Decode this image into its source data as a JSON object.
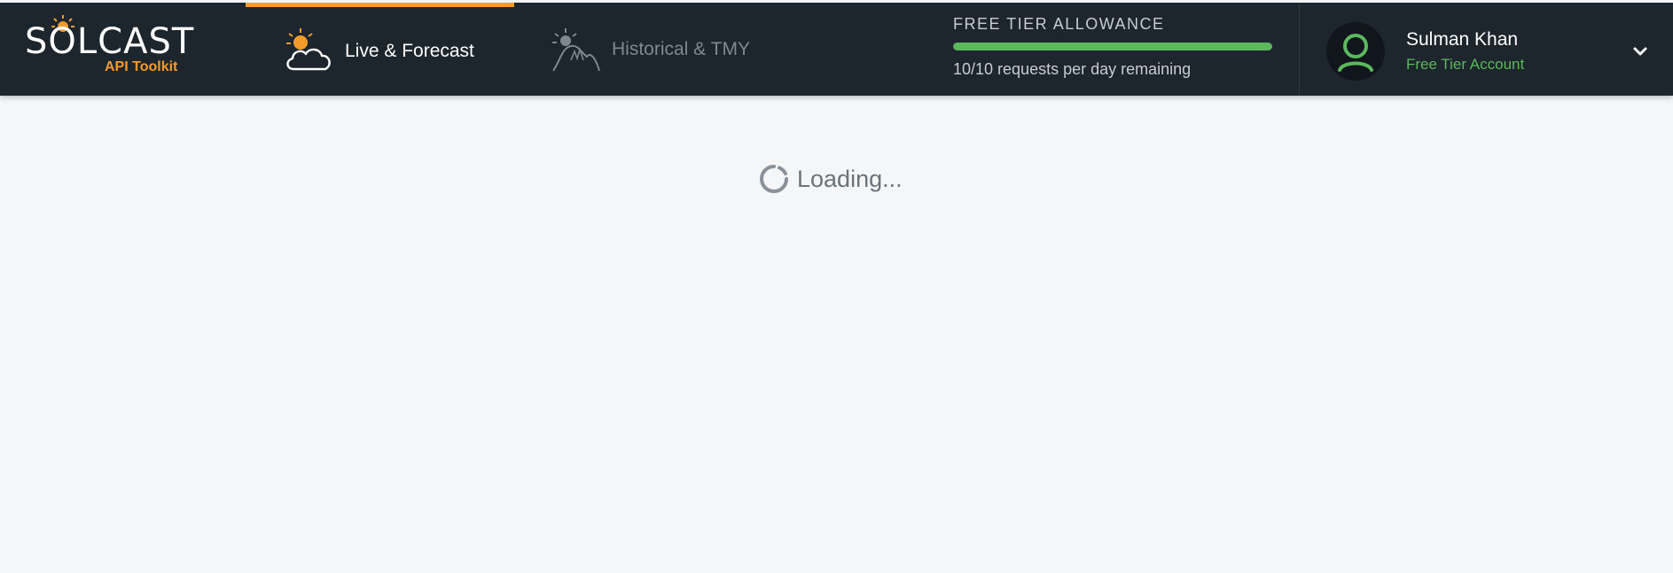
{
  "brand": {
    "name": "SOLCAST",
    "subtitle": "API Toolkit",
    "accent_color": "#f39c2c"
  },
  "nav": {
    "tabs": [
      {
        "label": "Live & Forecast",
        "icon": "sun-cloud-icon",
        "active": true
      },
      {
        "label": "Historical & TMY",
        "icon": "sun-mountain-icon",
        "active": false
      }
    ]
  },
  "allowance": {
    "title": "FREE TIER ALLOWANCE",
    "remaining_text": "10/10 requests per day remaining",
    "fraction_remaining": 1.0,
    "bar_color": "#5cb85c"
  },
  "user": {
    "name": "Sulman Khan",
    "tier": "Free Tier Account",
    "avatar_icon": "user-avatar-icon",
    "menu_icon": "chevron-down-icon"
  },
  "main": {
    "loading_text": "Loading..."
  }
}
